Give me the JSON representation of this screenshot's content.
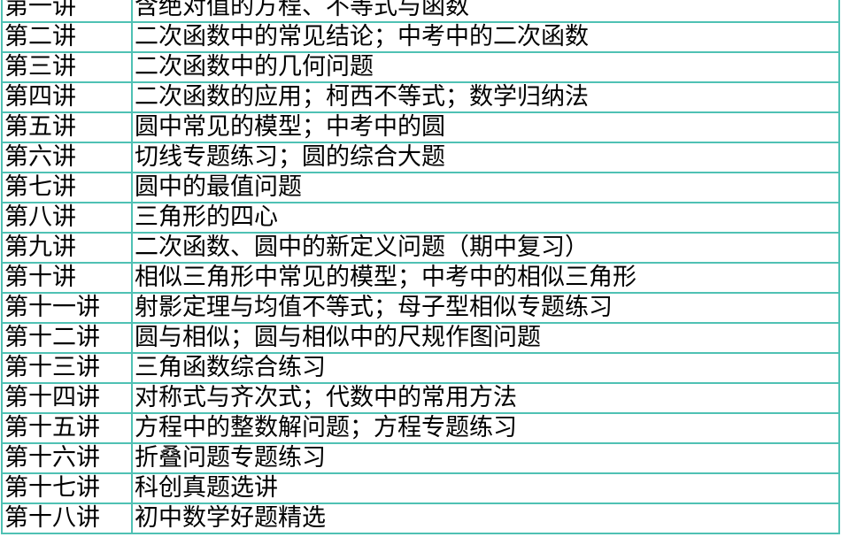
{
  "table": {
    "rows": [
      {
        "lesson": "第一讲",
        "topic": "含绝对值的方程、不等式与函数"
      },
      {
        "lesson": "第二讲",
        "topic": "二次函数中的常见结论；中考中的二次函数"
      },
      {
        "lesson": "第三讲",
        "topic": "二次函数中的几何问题"
      },
      {
        "lesson": "第四讲",
        "topic": "二次函数的应用；柯西不等式；数学归纳法"
      },
      {
        "lesson": "第五讲",
        "topic": "圆中常见的模型；中考中的圆"
      },
      {
        "lesson": "第六讲",
        "topic": "切线专题练习；圆的综合大题"
      },
      {
        "lesson": "第七讲",
        "topic": "圆中的最值问题"
      },
      {
        "lesson": "第八讲",
        "topic": "三角形的四心"
      },
      {
        "lesson": "第九讲",
        "topic": "二次函数、圆中的新定义问题（期中复习）"
      },
      {
        "lesson": "第十讲",
        "topic": "相似三角形中常见的模型；中考中的相似三角形"
      },
      {
        "lesson": "第十一讲",
        "topic": "射影定理与均值不等式；母子型相似专题练习"
      },
      {
        "lesson": "第十二讲",
        "topic": "圆与相似；圆与相似中的尺规作图问题"
      },
      {
        "lesson": "第十三讲",
        "topic": "三角函数综合练习"
      },
      {
        "lesson": "第十四讲",
        "topic": "对称式与齐次式；代数中的常用方法"
      },
      {
        "lesson": "第十五讲",
        "topic": "方程中的整数解问题；方程专题练习"
      },
      {
        "lesson": "第十六讲",
        "topic": "折叠问题专题练习"
      },
      {
        "lesson": "第十七讲",
        "topic": "科创真题选讲"
      },
      {
        "lesson": "第十八讲",
        "topic": "初中数学好题精选"
      }
    ]
  },
  "colors": {
    "grid": "#4fc1b4",
    "text": "#000000",
    "background": "#ffffff"
  }
}
